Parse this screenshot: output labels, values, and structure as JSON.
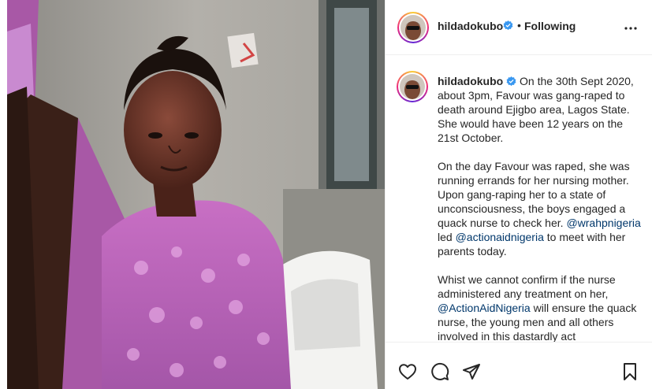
{
  "post": {
    "author": {
      "username": "hildadokubo",
      "verified": true,
      "separator": "•",
      "follow_label": "Following"
    },
    "caption": {
      "username": "hildadokubo",
      "paragraphs": [
        {
          "text": "On the 30th Sept 2020, about 3pm, Favour was gang-raped to death around Ejigbo area, Lagos State. She would have been 12 years on the 21st October."
        },
        {
          "text_a": "On the day Favour was raped, she was running errands for her nursing mother. Upon gang-raping her to a state of unconsciousness, the boys engaged a quack nurse to check her. ",
          "mention_a": "@wrahpnigeria",
          "text_b": " led ",
          "mention_b": "@actionaidnigeria",
          "text_c": " to meet with her parents today."
        },
        {
          "text_a": "Whist we cannot confirm if the nurse administered any treatment on her, ",
          "mention_a": "@ActionAidNigeria",
          "text_b": " will ensure the quack nurse, the young men and all others involved in this dastardly act"
        }
      ]
    }
  },
  "icons": {
    "more": "more-options-icon",
    "like": "heart-icon",
    "comment": "comment-icon",
    "share": "paper-plane-icon",
    "save": "bookmark-icon",
    "verified": "verified-badge-icon"
  },
  "colors": {
    "mention": "#00376b",
    "verified": "#3897f0",
    "text": "#262626",
    "border": "#efefef"
  }
}
